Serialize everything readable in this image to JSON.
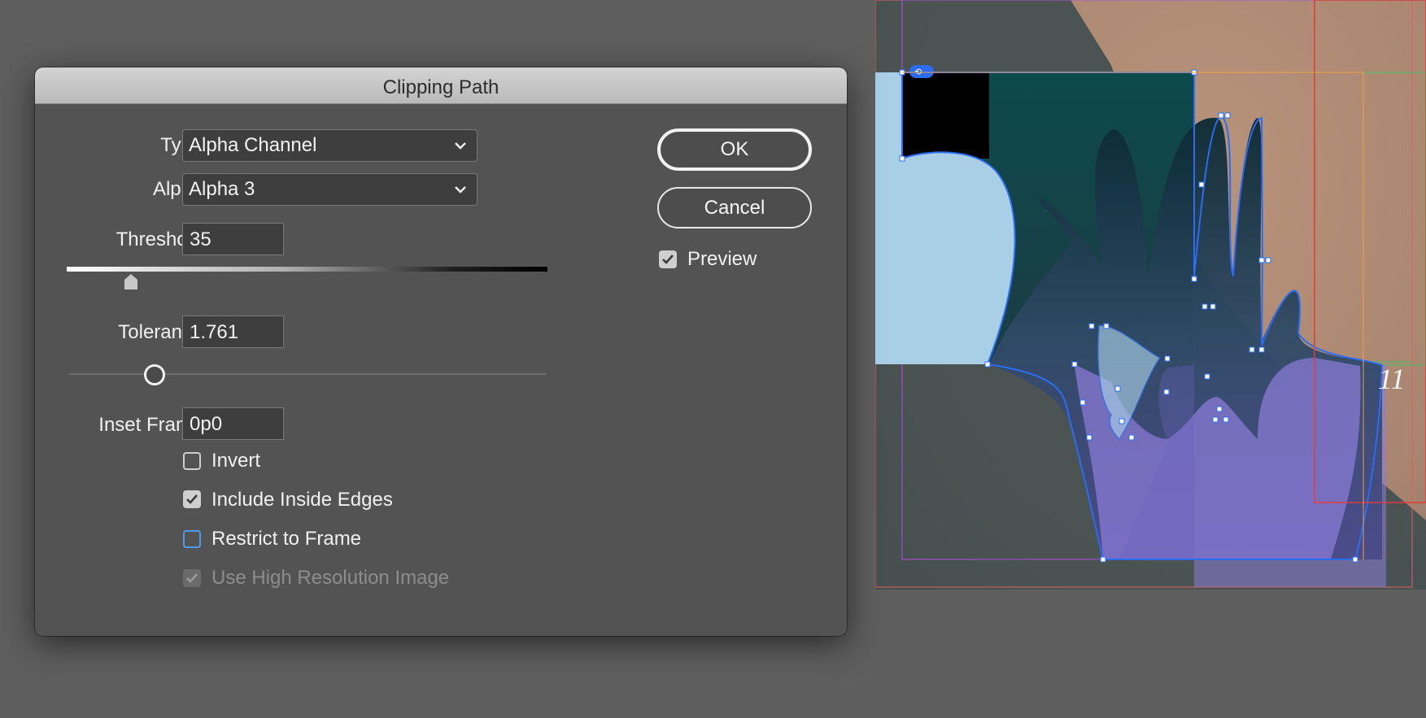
{
  "dialog": {
    "title": "Clipping Path",
    "type_label": "Type:",
    "type_value": "Alpha Channel",
    "alpha_label": "Alpha:",
    "alpha_value": "Alpha 3",
    "threshold_label": "Threshold:",
    "threshold_value": "35",
    "threshold_level": 0.13,
    "tolerance_label": "Tolerance:",
    "tolerance_value": "1.761",
    "tolerance_level": 0.18,
    "inset_label": "Inset Frame:",
    "inset_value": "0p0",
    "invert": {
      "label": "Invert",
      "checked": false
    },
    "include_inside_edges": {
      "label": "Include Inside Edges",
      "checked": true
    },
    "restrict_to_frame": {
      "label": "Restrict to Frame",
      "checked": false,
      "focused": true
    },
    "use_high_res": {
      "label": "Use High Resolution Image",
      "checked": true,
      "disabled": true
    },
    "ok_label": "OK",
    "cancel_label": "Cancel",
    "preview": {
      "label": "Preview",
      "checked": true
    }
  },
  "canvas": {
    "page_text": "11",
    "colors": {
      "clip_path_stroke": "#2a6df4",
      "clip_fill": "#8a7bd6",
      "background_fill": "#a9cfe6",
      "margin_line": "#e23b3b",
      "bleed_line": "#f0a040"
    }
  }
}
